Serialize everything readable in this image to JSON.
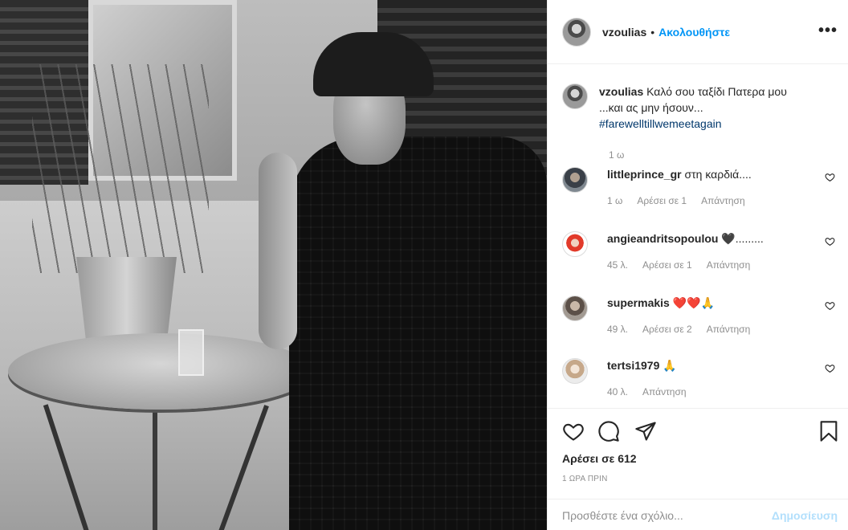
{
  "post": {
    "author": "vzoulias",
    "separator": "•",
    "follow_label": "Ακολουθήστε",
    "more_label": "•••",
    "caption": {
      "username": "vzoulias",
      "text_line1": " Καλό σου ταξίδι Πατερα μου",
      "text_line2": "...και ας μην ήσουν...",
      "hashtag": "#farewelltillwemeetagain",
      "time": "1 ω"
    },
    "comments": [
      {
        "username": "littleprince_gr",
        "text": " στη καρδιά....",
        "time": "1 ω",
        "likes": "Αρέσει σε 1",
        "reply": "Απάντηση"
      },
      {
        "username": "angieandritsopoulou",
        "text": " 🖤.........",
        "time": "45 λ.",
        "likes": "Αρέσει σε 1",
        "reply": "Απάντηση"
      },
      {
        "username": "supermakis",
        "text": " ❤️❤️🙏",
        "time": "49 λ.",
        "likes": "Αρέσει σε 2",
        "reply": "Απάντηση"
      },
      {
        "username": "tertsi1979",
        "text": " 🙏",
        "time": "40 λ.",
        "likes": "",
        "reply": "Απάντηση"
      }
    ],
    "likes_label": "Αρέσει σε 612",
    "post_time": "1 ΩΡΑ ΠΡΙΝ",
    "comment_placeholder": "Προσθέστε ένα σχόλιο...",
    "post_button": "Δημοσίευση",
    "colors": {
      "link": "#0095f6",
      "hashtag": "#00376b",
      "muted": "#8e8e8e",
      "post_disabled": "#b2dffc"
    },
    "icons": [
      "heart-icon",
      "comment-icon",
      "share-icon",
      "bookmark-icon",
      "more-icon"
    ]
  }
}
